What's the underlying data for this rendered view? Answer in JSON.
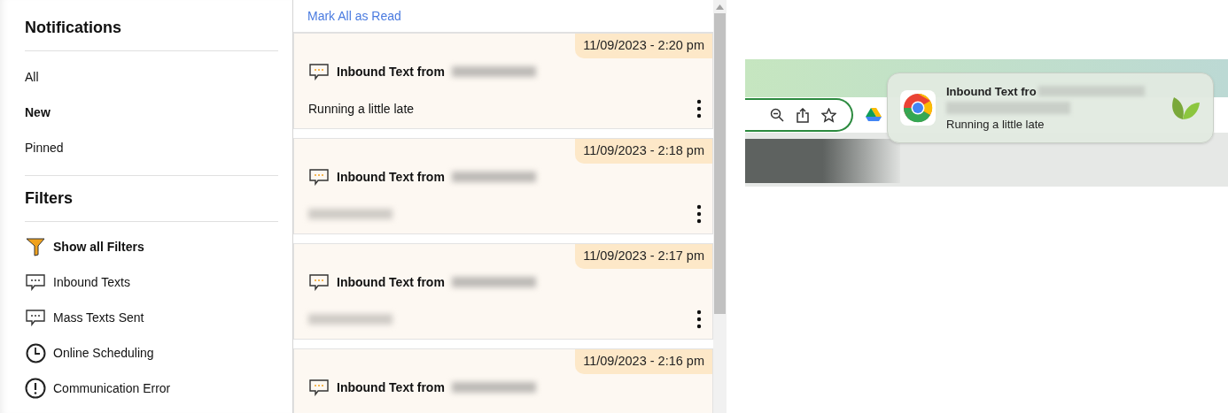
{
  "sidebar": {
    "title": "Notifications",
    "views": [
      {
        "label": "All",
        "selected": false
      },
      {
        "label": "New",
        "selected": true
      },
      {
        "label": "Pinned",
        "selected": false
      }
    ],
    "filters_title": "Filters",
    "filters": [
      {
        "kind": "funnel",
        "label": "Show all Filters",
        "selected": true
      },
      {
        "kind": "chat",
        "label": "Inbound Texts",
        "selected": false
      },
      {
        "kind": "chat",
        "label": "Mass Texts Sent",
        "selected": false
      },
      {
        "kind": "clock",
        "label": "Online Scheduling",
        "selected": false
      },
      {
        "kind": "alert",
        "label": "Communication Error",
        "selected": false
      }
    ]
  },
  "feed": {
    "action": "Mark All as Read",
    "items": [
      {
        "timestamp": "11/09/2023 - 2:20 pm",
        "title": "Inbound Text from",
        "message": "Running a little late"
      },
      {
        "timestamp": "11/09/2023 - 2:18 pm",
        "title": "Inbound Text from",
        "message_redacted": true
      },
      {
        "timestamp": "11/09/2023 - 2:17 pm",
        "title": "Inbound Text from",
        "message_redacted": true
      },
      {
        "timestamp": "11/09/2023 - 2:16 pm",
        "title": "Inbound Text from"
      }
    ]
  },
  "desktop_notification": {
    "title": "Inbound Text fro",
    "message": "Running a little late"
  }
}
